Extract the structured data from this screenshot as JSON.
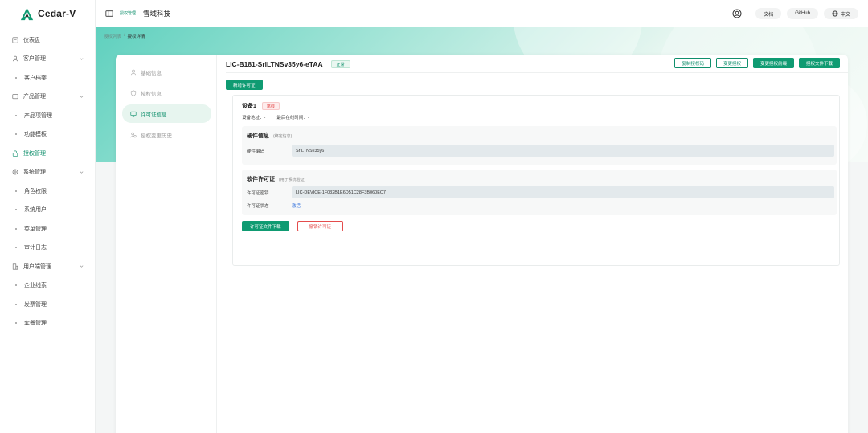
{
  "brand": {
    "name": "Cedar-V"
  },
  "sidebar": {
    "items": [
      {
        "label": "仪表盘",
        "type": "top",
        "icon": "dashboard-icon"
      },
      {
        "label": "客户管理",
        "type": "group",
        "icon": "user-icon"
      },
      {
        "label": "客户档案",
        "type": "sub"
      },
      {
        "label": "产品管理",
        "type": "group",
        "icon": "box-icon"
      },
      {
        "label": "产品项管理",
        "type": "sub"
      },
      {
        "label": "功能模板",
        "type": "sub"
      },
      {
        "label": "授权管理",
        "type": "top",
        "icon": "lock-icon",
        "active": true
      },
      {
        "label": "系统管理",
        "type": "group",
        "icon": "gear-icon"
      },
      {
        "label": "角色权限",
        "type": "sub"
      },
      {
        "label": "系统用户",
        "type": "sub"
      },
      {
        "label": "菜单管理",
        "type": "sub"
      },
      {
        "label": "审计日志",
        "type": "sub"
      },
      {
        "label": "用户端管理",
        "type": "group",
        "icon": "building-icon"
      },
      {
        "label": "企业线索",
        "type": "sub"
      },
      {
        "label": "发票管理",
        "type": "sub"
      },
      {
        "label": "套餐管理",
        "type": "sub"
      }
    ]
  },
  "header": {
    "badge": "授权管理",
    "org": "雪域科技",
    "docs": "文档",
    "github": "GitHub",
    "lang": "中文"
  },
  "breadcrumb": {
    "parent": "授权列表",
    "sep": "/",
    "current": "授权详情"
  },
  "tabs": [
    {
      "label": "基础信息",
      "icon": "user-icon"
    },
    {
      "label": "授权信息",
      "icon": "shield-icon"
    },
    {
      "label": "许可证信息",
      "icon": "monitor-icon",
      "active": true
    },
    {
      "label": "授权变更历史",
      "icon": "history-icon"
    }
  ],
  "license": {
    "title": "LIC-B181-SrlLTNSv35y6-eTAA",
    "status": "正常",
    "actions": {
      "copy": "复制授权码",
      "change": "变更授权",
      "change_file": "变更授权前缀",
      "download": "授权文件下载"
    },
    "add_button": "新增许可证"
  },
  "device": {
    "name": "设备1",
    "status": "离线",
    "address_label": "设备地址：",
    "address_value": "-",
    "last_online_label": "最后在线时间：",
    "last_online_value": "-",
    "hardware": {
      "title": "硬件信息",
      "hint": "(绑定信息)",
      "code_label": "硬件编码",
      "code_value": "SrILTNSv35y6"
    },
    "software": {
      "title": "软件许可证",
      "hint": "(用于系统验证)",
      "key_label": "许可证密钥",
      "key_value": "LIC-DEVICE-1F032B1E6D51C28F3B060EC7",
      "state_label": "许可证状态",
      "state_value": "激活"
    },
    "download_btn": "许可证文件下载",
    "revoke_btn": "撤销许可证"
  },
  "colors": {
    "accent": "#0f8f6c",
    "danger": "#e44c4c",
    "link": "#2f6fdc"
  }
}
